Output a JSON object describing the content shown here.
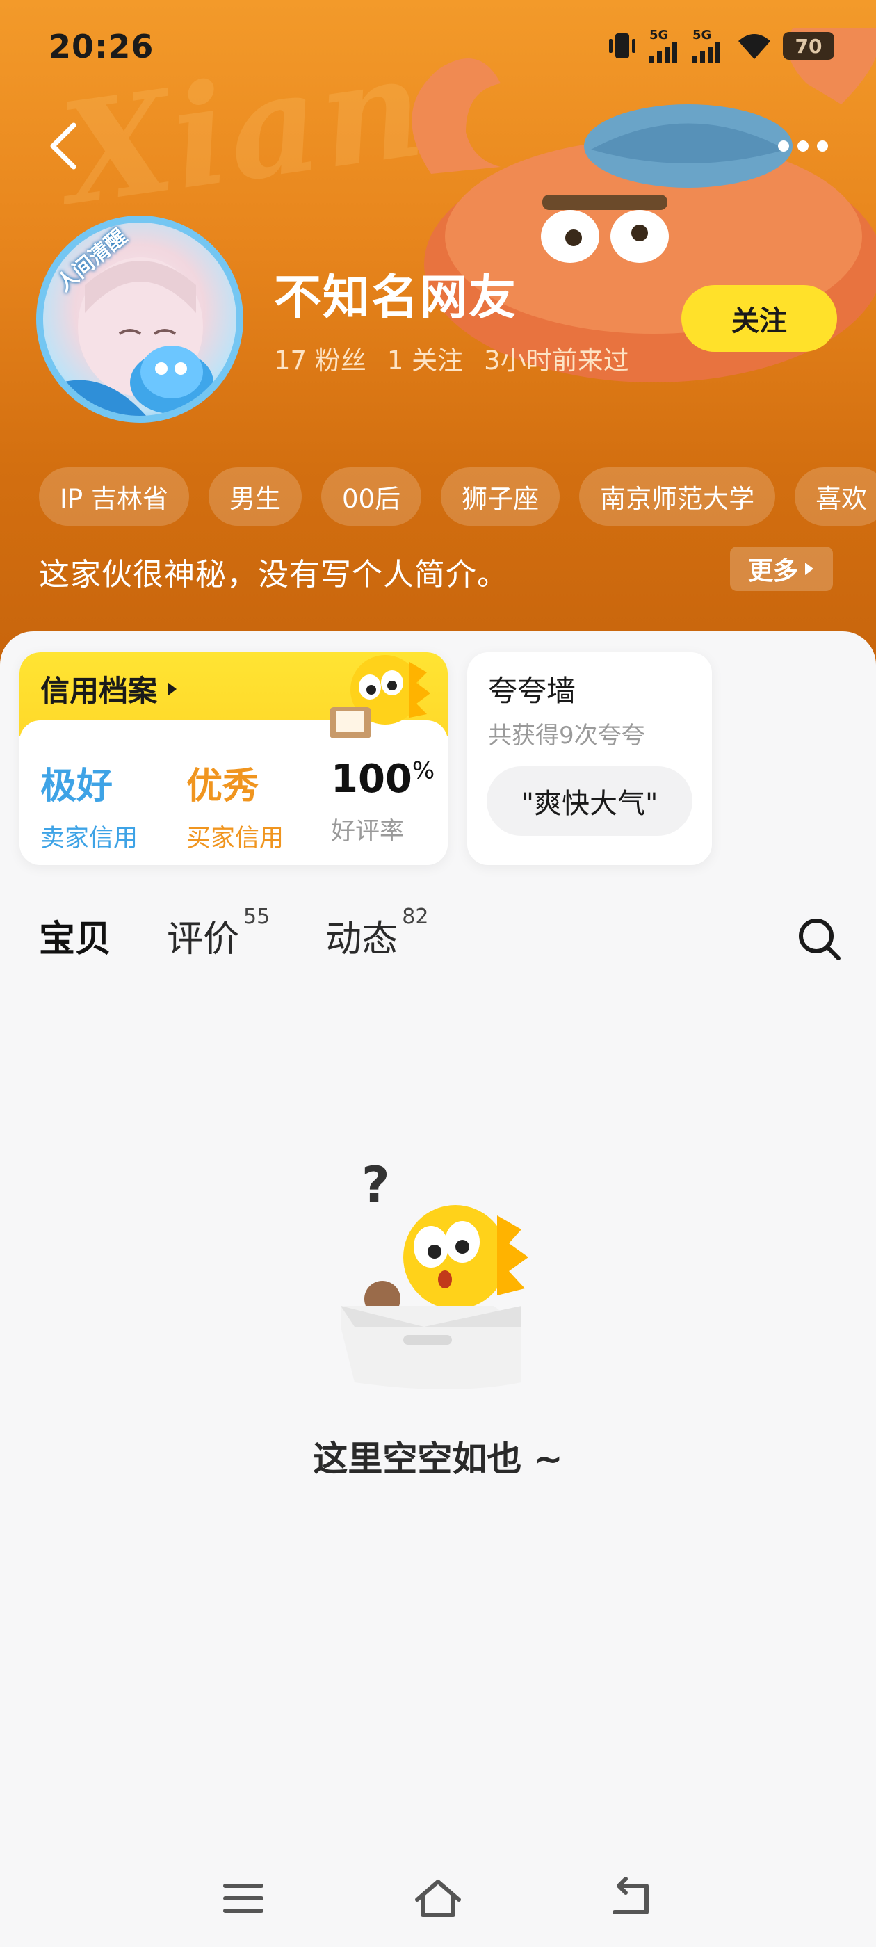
{
  "status_bar": {
    "time": "20:26",
    "network_1": "5G",
    "network_2": "5G",
    "battery": "70"
  },
  "header": {
    "bg_word": "Xian"
  },
  "avatar": {
    "badge_text": "人间清醒"
  },
  "profile": {
    "name": "不知名网友",
    "followers": "17 粉丝",
    "following": "1 关注",
    "last_seen": "3小时前来过",
    "follow_label": "关注",
    "tags": [
      "IP 吉林省",
      "男生",
      "00后",
      "狮子座",
      "南京师范大学",
      "喜欢"
    ],
    "bio": "这家伙很神秘，没有写个人简介。",
    "bio_more": "更多"
  },
  "credit": {
    "title": "信用档案",
    "seller_rating": "极好",
    "seller_label": "卖家信用",
    "buyer_rating": "优秀",
    "buyer_label": "买家信用",
    "good_rate_value": "100",
    "good_rate_unit": "%",
    "good_rate_label": "好评率"
  },
  "praise": {
    "title": "夸夸墙",
    "subtitle": "共获得9次夸夸",
    "chip": "\"爽快大气\""
  },
  "tabs": [
    {
      "label": "宝贝",
      "count": ""
    },
    {
      "label": "评价",
      "count": "55"
    },
    {
      "label": "动态",
      "count": "82"
    }
  ],
  "empty": {
    "text": "这里空空如也 ~"
  },
  "colors": {
    "header_orange": "#e8861d",
    "accent_yellow": "#ffe12a",
    "seller_blue": "#3ea3e6",
    "buyer_orange": "#f0951f"
  },
  "icons": [
    "back-arrow-icon",
    "more-dots-icon",
    "search-icon",
    "menu-icon",
    "home-icon",
    "back-nav-icon",
    "vibrate-icon",
    "signal-icon",
    "wifi-icon",
    "battery-icon"
  ]
}
